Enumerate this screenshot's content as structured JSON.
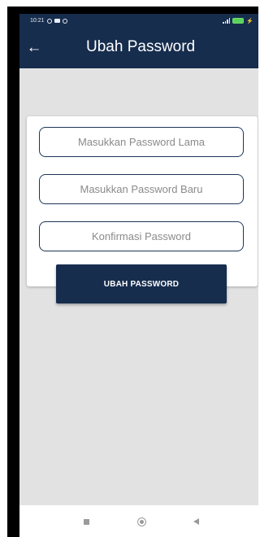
{
  "status_bar": {
    "time": "10:21",
    "icons": [
      "whatsapp-icon",
      "video-icon",
      "chat-icon",
      "signal-icon",
      "battery-icon",
      "charging-icon"
    ]
  },
  "app_bar": {
    "title": "Ubah Password",
    "back_icon": "arrow-left-icon",
    "back_glyph": "←"
  },
  "form": {
    "old_password_placeholder": "Masukkan Password Lama",
    "new_password_placeholder": "Masukkan Password Baru",
    "confirm_password_placeholder": "Konfirmasi Password",
    "submit_label": "UBAH PASSWORD"
  },
  "nav_bar": {
    "icons": [
      "recent-apps-icon",
      "home-icon",
      "back-icon"
    ]
  },
  "colors": {
    "primary": "#162d4e",
    "background": "#e2e2e2",
    "card": "#ffffff"
  }
}
